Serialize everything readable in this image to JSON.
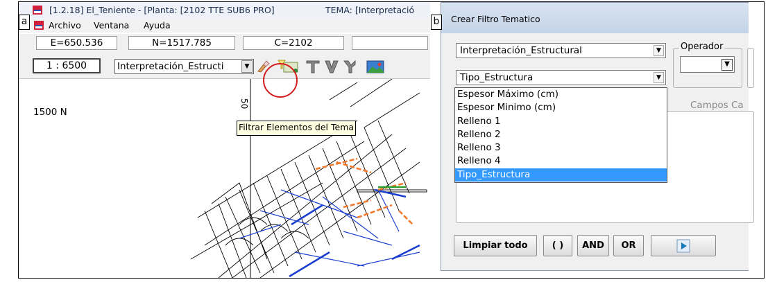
{
  "labels": {
    "a": "a",
    "b": "b"
  },
  "window_a": {
    "title": "[1.2.18] El_Teniente - [Planta: [2102 TTE SUB6 PRO]",
    "tema": "TEMA: [Interpretació",
    "menu": [
      "Archivo",
      "Ventana",
      "Ayuda"
    ],
    "status": {
      "e": "E=650.536",
      "n": "N=1517.785",
      "c": "C=2102"
    },
    "scale": "1 : 6500",
    "layer_combo": "Interpretación_Estructi",
    "map_label": "1500 N",
    "map_number": "50",
    "tooltip": "Filtrar Elementos del Tema",
    "icons": [
      "erase-icon",
      "filter-theme-icon",
      "filter-t-icon",
      "filter-v-icon",
      "filter-y-icon",
      "image-icon"
    ]
  },
  "dialog_b": {
    "title": "Crear Filtro Tematico",
    "layer_select": "Interpretación_Estructural",
    "field_select": "Tipo_Estructura",
    "operator_label": "Operador",
    "field_options": [
      "Espesor Máximo (cm)",
      "Espesor Minimo (cm)",
      "Relleno 1",
      "Relleno 2",
      "Relleno 3",
      "Relleno 4",
      "Tipo_Estructura"
    ],
    "selected_index": 6,
    "campos_label": "Campos Ca",
    "buttons": {
      "clear": "Limpiar todo",
      "paren": "( )",
      "and": "AND",
      "or": "OR"
    },
    "run_icon": "play-icon"
  },
  "colors": {
    "highlight": "#d51a1a",
    "selection": "#3399ff",
    "tooltip_bg": "#ffffe1"
  }
}
